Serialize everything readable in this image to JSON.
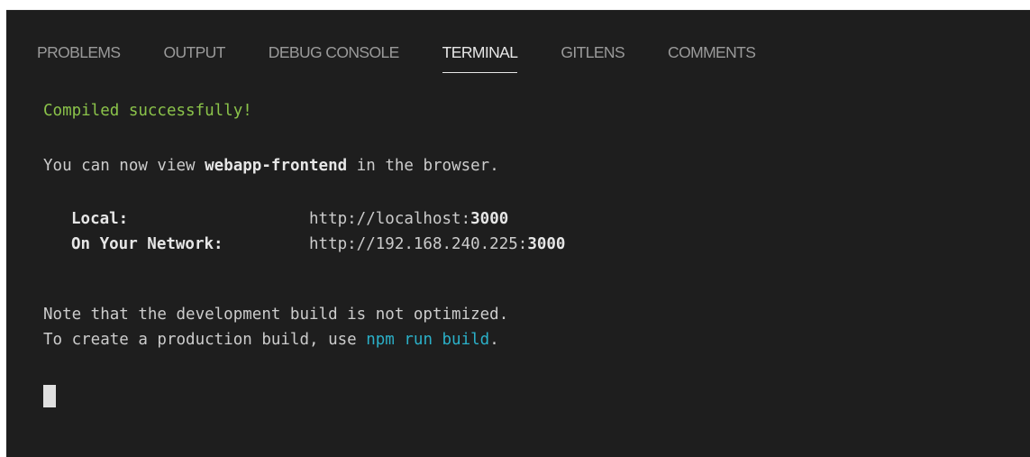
{
  "tabs": [
    {
      "label": "PROBLEMS"
    },
    {
      "label": "OUTPUT"
    },
    {
      "label": "DEBUG CONSOLE"
    },
    {
      "label": "TERMINAL",
      "active": true
    },
    {
      "label": "GITLENS"
    },
    {
      "label": "COMMENTS"
    }
  ],
  "terminal": {
    "status": "Compiled successfully!",
    "view_prefix": "You can now view ",
    "app_name": "webapp-frontend",
    "view_suffix": " in the browser.",
    "local_label": "Local:",
    "local_url_prefix": "http://localhost:",
    "local_port": "3000",
    "network_label": "On Your Network:",
    "network_url_prefix": "http://192.168.240.225:",
    "network_port": "3000",
    "note_line": "Note that the development build is not optimized.",
    "create_prefix": "To create a production build, use ",
    "create_cmd": "npm run build",
    "create_suffix": "."
  },
  "colors": {
    "background": "#1e1e1e",
    "success": "#8bc34a",
    "command": "#2bb0c8",
    "tab_active": "#e7e7e7",
    "tab_inactive": "#9a9a9a"
  }
}
